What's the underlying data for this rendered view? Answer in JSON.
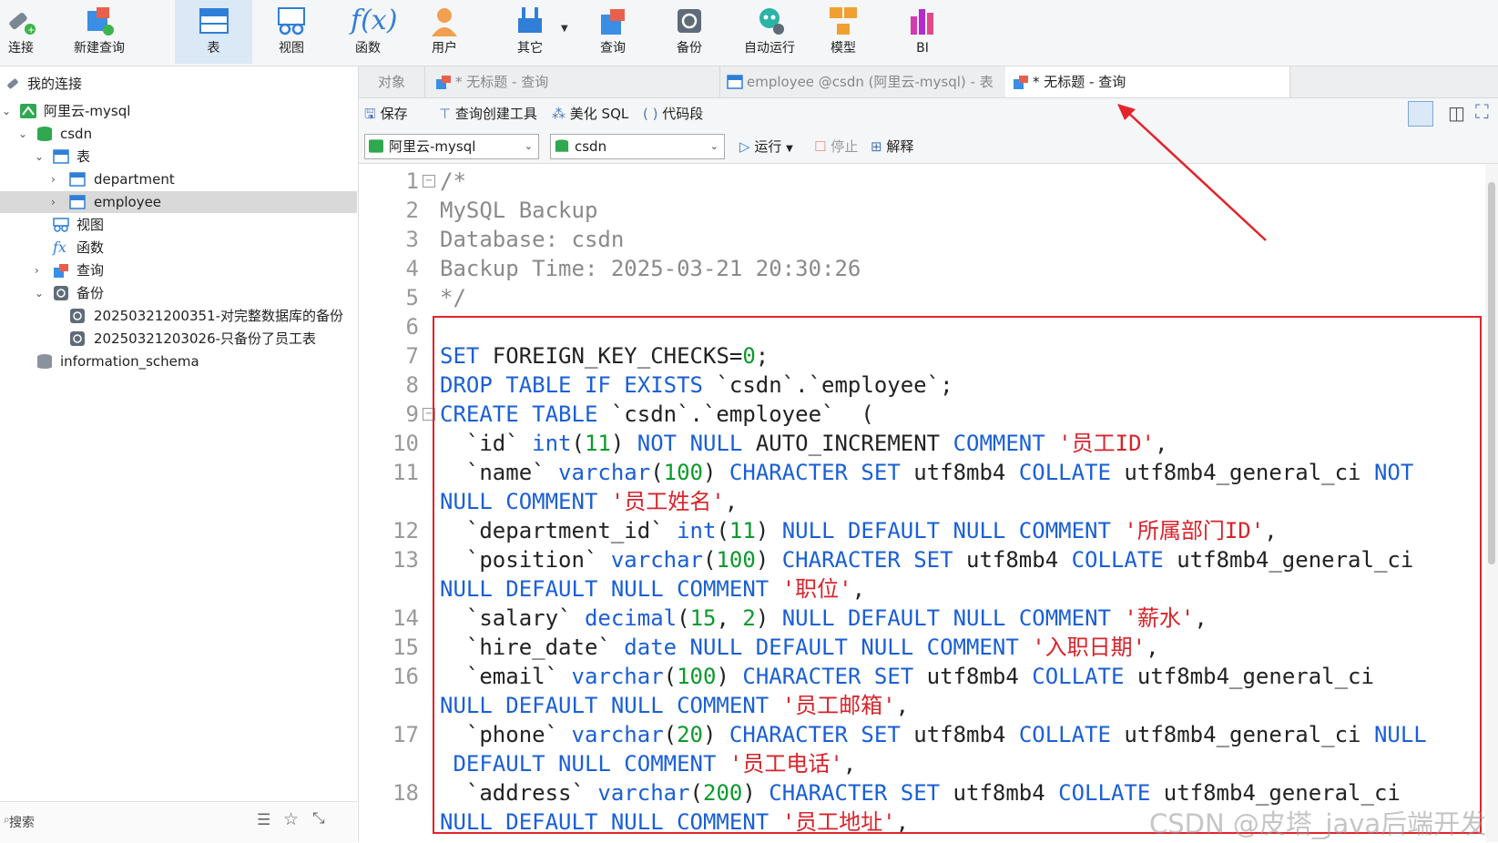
{
  "toolbar": {
    "connect": "连接",
    "new_query": "新建查询",
    "table": "表",
    "view": "视图",
    "function": "函数",
    "user": "用户",
    "other": "其它",
    "query": "查询",
    "backup": "备份",
    "automation": "自动运行",
    "model": "模型",
    "bi": "BI"
  },
  "sidebar": {
    "header": "我的连接",
    "connection": "阿里云-mysql",
    "database": "csdn",
    "tables_group": "表",
    "table_1": "department",
    "table_2": "employee",
    "views": "视图",
    "functions": "函数",
    "queries": "查询",
    "backups": "备份",
    "backup_1": "20250321200351-对完整数据库的备份",
    "backup_2": "20250321203026-只备份了员工表",
    "schema_2": "information_schema",
    "search_placeholder": "搜索"
  },
  "tabs": {
    "objects": "对象",
    "tab_1": "* 无标题 - 查询",
    "tab_2": "employee @csdn (阿里云-mysql) - 表",
    "tab_3": "* 无标题 - 查询"
  },
  "query_toolbar": {
    "save": "保存",
    "query_builder": "查询创建工具",
    "beautify": "美化 SQL",
    "snippet": "代码段",
    "run": "运行",
    "stop": "停止",
    "explain": "解释"
  },
  "selectors": {
    "connection": "阿里云-mysql",
    "database": "csdn"
  },
  "line_numbers": [
    "1",
    "2",
    "3",
    "4",
    "5",
    "6",
    "7",
    "8",
    "9",
    "10",
    "11",
    "",
    "12",
    "13",
    "",
    "14",
    "15",
    "16",
    "",
    "17",
    "",
    "18"
  ],
  "watermark": "CSDN @皮塔_java后端开发",
  "colors": {
    "keyword": "#1a5fd6",
    "number": "#0a9a2a",
    "string": "#d8232a",
    "comment": "#8a8a8a",
    "annotation_red": "#e3242b"
  }
}
